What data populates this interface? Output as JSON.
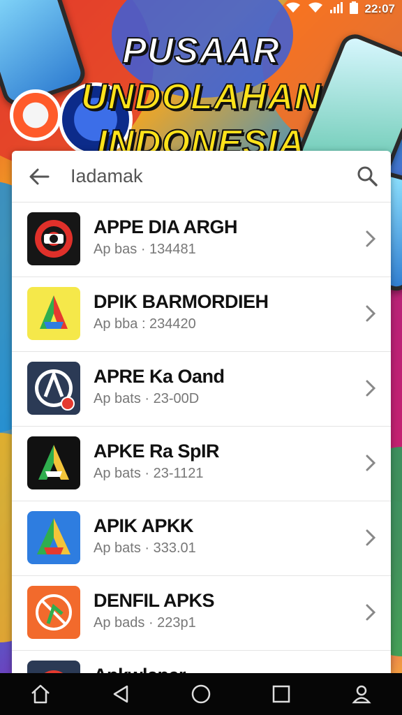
{
  "status_bar": {
    "time": "22:07",
    "icons": [
      "wifi-icon",
      "wifi-icon",
      "signal-icon",
      "battery-icon"
    ]
  },
  "headline": {
    "line1_a": "PUSAAR",
    "line1_b": "UNDOLAHAN",
    "line2": "INDONESIA"
  },
  "search": {
    "query": "Iadamak",
    "back_icon": "back-arrow-icon",
    "search_icon": "search-icon"
  },
  "apps": [
    {
      "name": "APPE DIA ARGH",
      "meta": "Ap bas · 134481",
      "icon_colors": [
        "#1a1a1a",
        "#e0302a"
      ]
    },
    {
      "name": "DPIK BARMORDIEH",
      "meta": "Ap bba : 234420",
      "icon_colors": [
        "#f5e84a",
        "#2e7de0",
        "#e53a2f",
        "#2fae4e"
      ]
    },
    {
      "name": "APRE Ka Oand",
      "meta": "Ap bats · 23-00D",
      "icon_colors": [
        "#2b3a55",
        "#e53a2f"
      ]
    },
    {
      "name": "APKE Ra SpIR",
      "meta": "Ap bats · 23-1121",
      "icon_colors": [
        "#111111",
        "#f3c43a",
        "#2fae4e"
      ]
    },
    {
      "name": "APIK APKK",
      "meta": "Ap bats · 333.01",
      "icon_colors": [
        "#2e7de0",
        "#f3c43a",
        "#e53a2f",
        "#2fae4e"
      ]
    },
    {
      "name": "DENFIL APKS",
      "meta": "Ap bads · 223p1",
      "icon_colors": [
        "#f26a2c",
        "#ffffff"
      ]
    },
    {
      "name": "Apkwlaper",
      "meta": "",
      "icon_colors": [
        "#2b3a55",
        "#e53a2f"
      ]
    }
  ],
  "nav": [
    "home-icon",
    "back-triangle-icon",
    "circle-home-icon",
    "recents-square-icon",
    "profile-icon"
  ]
}
